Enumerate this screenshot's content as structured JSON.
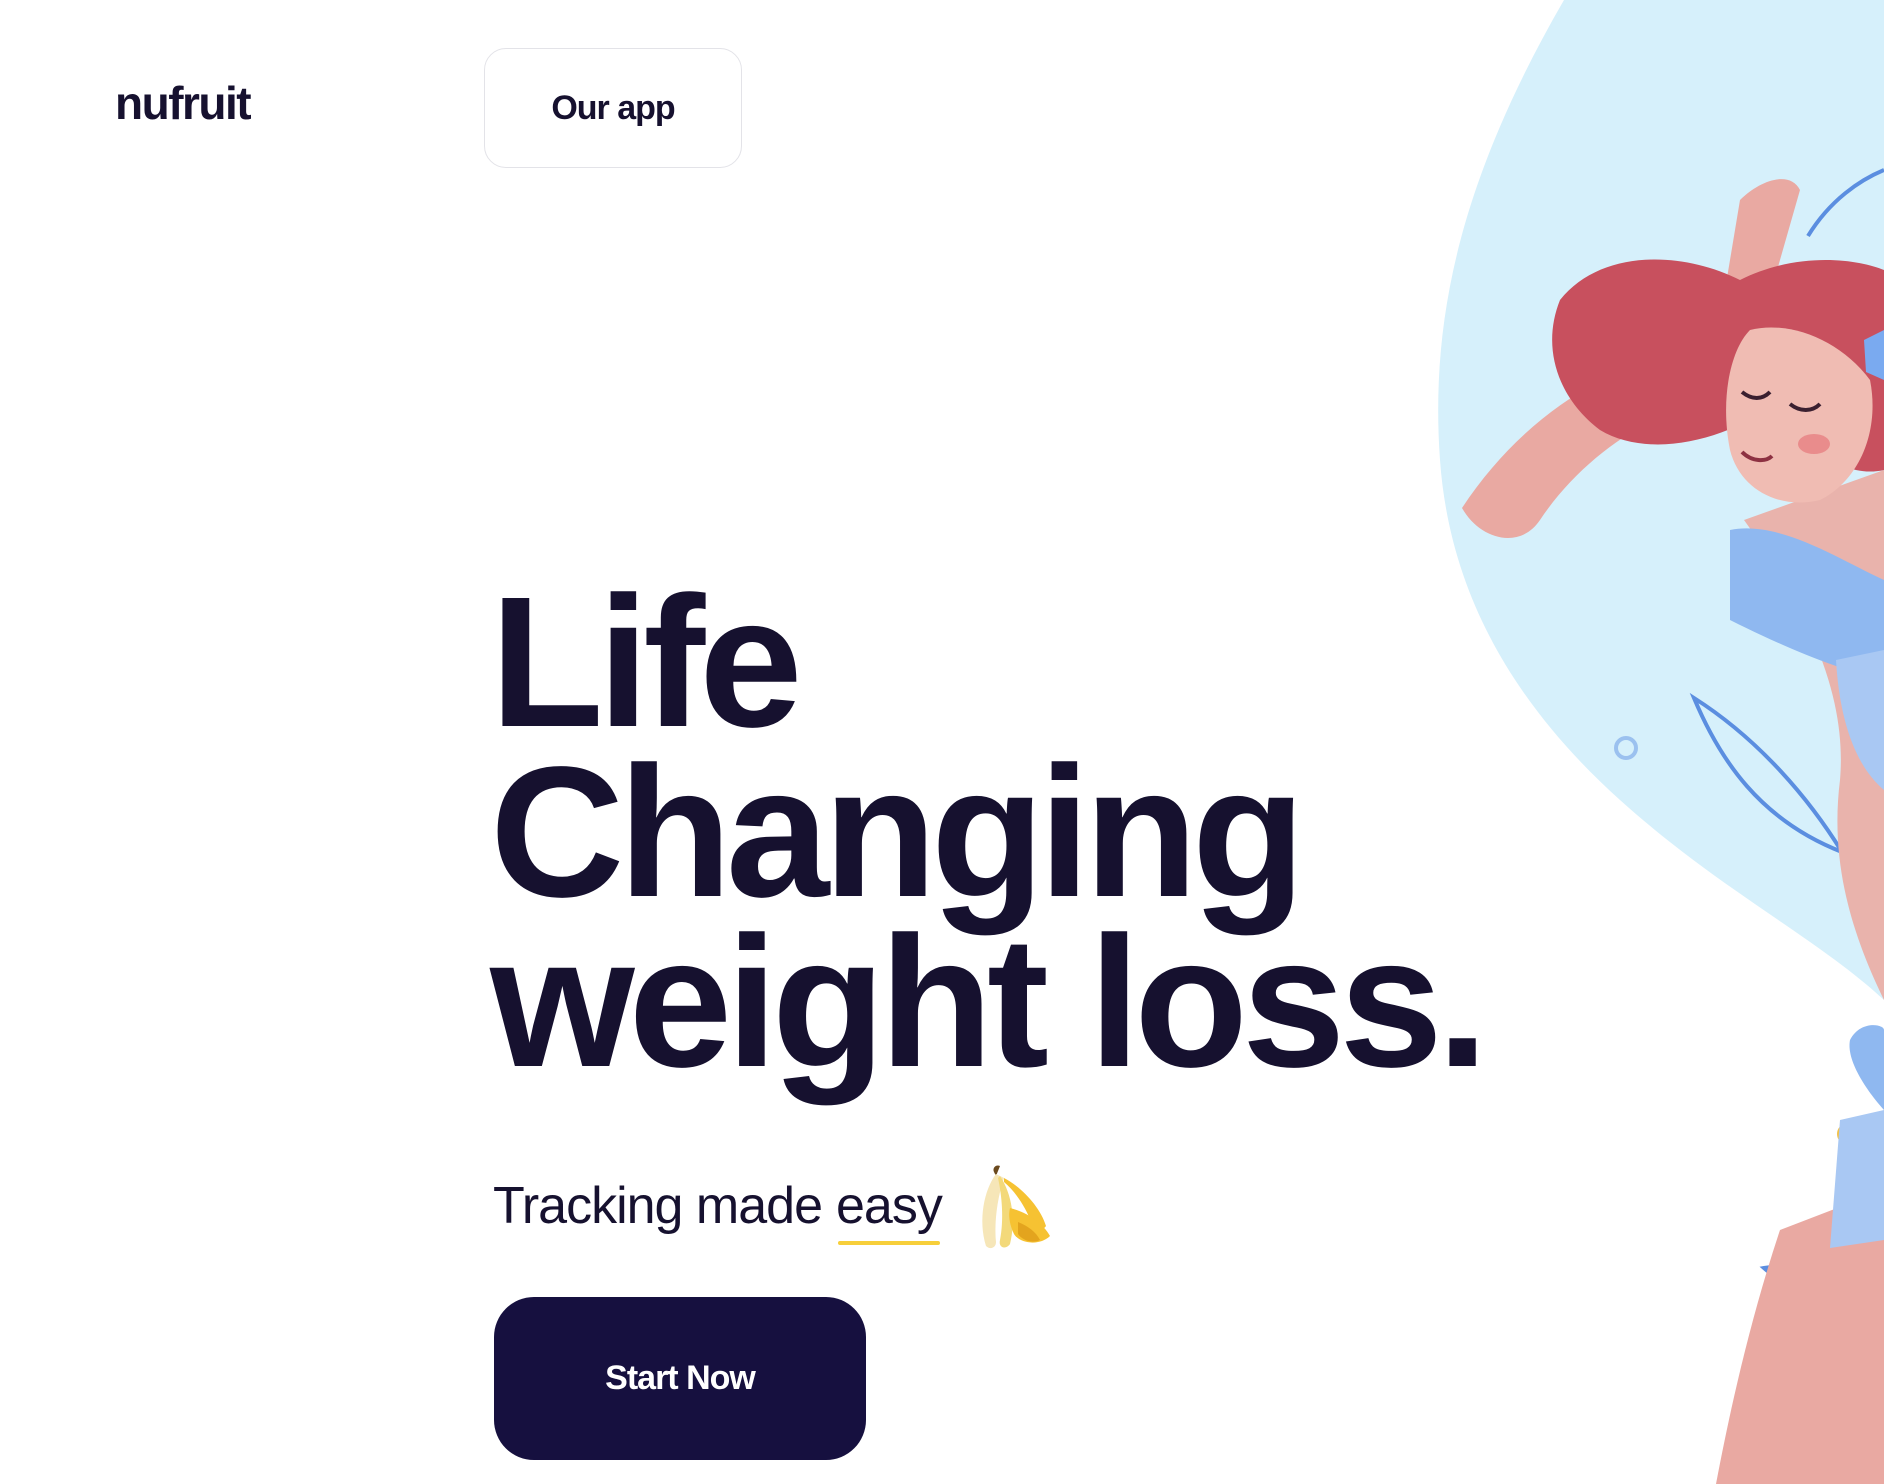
{
  "header": {
    "logo_text": "nufruit",
    "nav_button_label": "Our app"
  },
  "hero": {
    "title_line_1": "Life",
    "title_line_2": "Changing",
    "title_line_3": "weight loss.",
    "tagline_prefix": "Tracking made",
    "tagline_highlight": "easy",
    "tagline_icon": "banana-icon",
    "cta_label": "Start Now"
  },
  "colors": {
    "text_dark": "#16112f",
    "cta_background": "#16103f",
    "highlight_underline": "#f7cf3a",
    "illustration_background": "#d6f0fb"
  }
}
